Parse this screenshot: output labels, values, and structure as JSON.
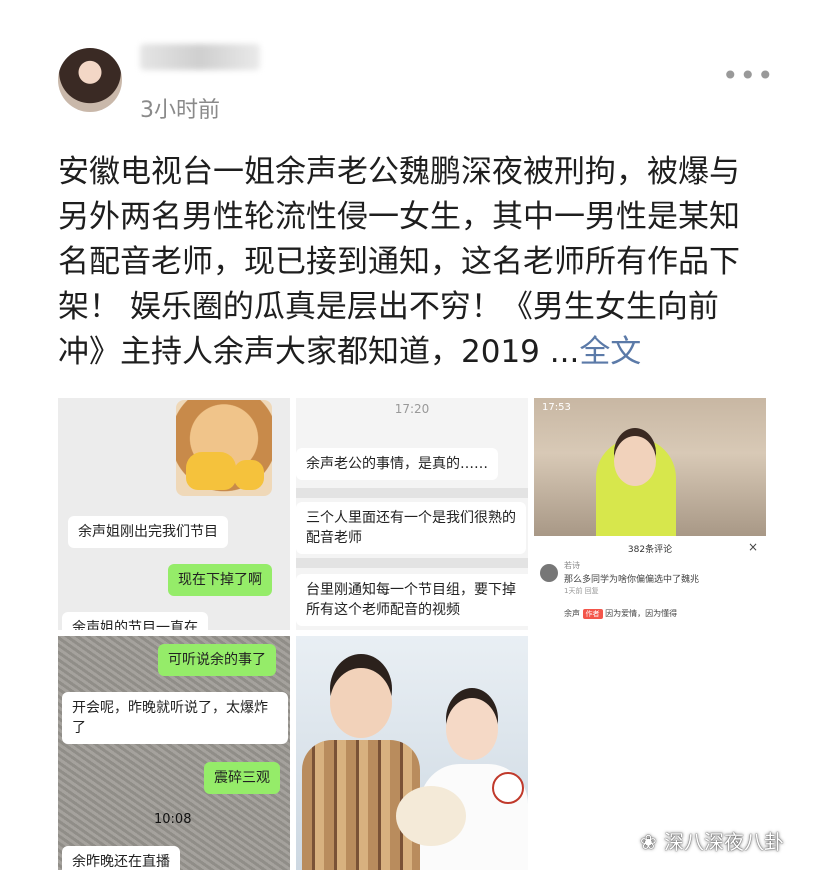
{
  "post": {
    "time": "3小时前",
    "text": "安徽电视台一姐余声老公魏鹏深夜被刑拘，被爆与另外两名男性轮流性侵一女生，其中一男性是某知名配音老师，现已接到通知，这名老师所有作品下架！ 娱乐圈的瓜真是层出不穷！《男生女生向前冲》主持人余声大家都知道，2019 ...",
    "more_label": "全文"
  },
  "images": {
    "tile1": {
      "msg1": "余声姐刚出完我们节目",
      "msg2": "现在下掉了啊",
      "msg3": "余声姐的节目一直在"
    },
    "tile2": {
      "status_time": "17:20",
      "msg1": "余声老公的事情，是真的……",
      "msg2": "三个人里面还有一个是我们很熟的配音老师",
      "msg3": "台里刚通知每一个节目组，要下掉所有这个老师配音的视频"
    },
    "tile3": {
      "status_time": "17:53",
      "comments_header": "382条评论",
      "close": "×",
      "comment_user": "若诗",
      "comment_text": "那么多同学为啥你偏偏选中了魏兆",
      "comment_meta": "1天前  回复",
      "reply_user": "余声",
      "reply_tag": "作者",
      "reply_text": "因为爱情，因为懂得"
    },
    "tile4": {
      "msg1": "可听说余的事了",
      "msg2": "开会呢，昨晚就听说了，太爆炸了",
      "msg3": "震碎三观",
      "timestamp": "10:08",
      "msg4": "余昨晚还在直播"
    }
  },
  "watermark": "深八深夜八卦",
  "icons": {
    "more": "more-dots-icon",
    "watermark": "wechat-channel-icon"
  }
}
